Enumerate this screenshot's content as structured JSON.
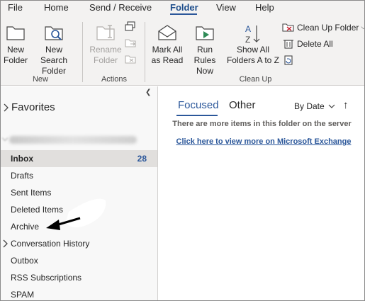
{
  "menu": {
    "tabs": [
      {
        "label": "File"
      },
      {
        "label": "Home"
      },
      {
        "label": "Send / Receive"
      },
      {
        "label": "Folder",
        "active": true
      },
      {
        "label": "View"
      },
      {
        "label": "Help"
      }
    ]
  },
  "ribbon": {
    "groups": {
      "new": "New",
      "actions": "Actions",
      "cleanup": "Clean Up"
    },
    "buttons": {
      "new_folder": [
        "New",
        "Folder"
      ],
      "new_search_folder": [
        "New Search",
        "Folder"
      ],
      "rename_folder": [
        "Rename",
        "Folder"
      ],
      "mark_all_as_read": [
        "Mark All",
        "as Read"
      ],
      "run_rules_now": [
        "Run Rules",
        "Now"
      ],
      "show_all_folders": [
        "Show All",
        "Folders A to Z"
      ],
      "clean_up_folder": "Clean Up Folder",
      "delete_all": "Delete All"
    }
  },
  "folder_pane": {
    "favorites": "Favorites",
    "folders": [
      {
        "label": "Inbox",
        "count": "28",
        "selected": true
      },
      {
        "label": "Drafts"
      },
      {
        "label": "Sent Items"
      },
      {
        "label": "Deleted Items"
      },
      {
        "label": "Archive"
      },
      {
        "label": "Conversation History",
        "expandable": true
      },
      {
        "label": "Outbox"
      },
      {
        "label": "RSS Subscriptions"
      },
      {
        "label": "SPAM"
      }
    ]
  },
  "message_list": {
    "focused_tab": "Focused",
    "other_tab": "Other",
    "sort": "By Date",
    "notice": "There are more items in this folder on the server",
    "exchange_link": "Click here to view more on Microsoft Exchange"
  },
  "colors": {
    "accent": "#2b579a",
    "ribbon_bg": "#f3f2f1",
    "selected_bg": "#e1dfdd"
  }
}
